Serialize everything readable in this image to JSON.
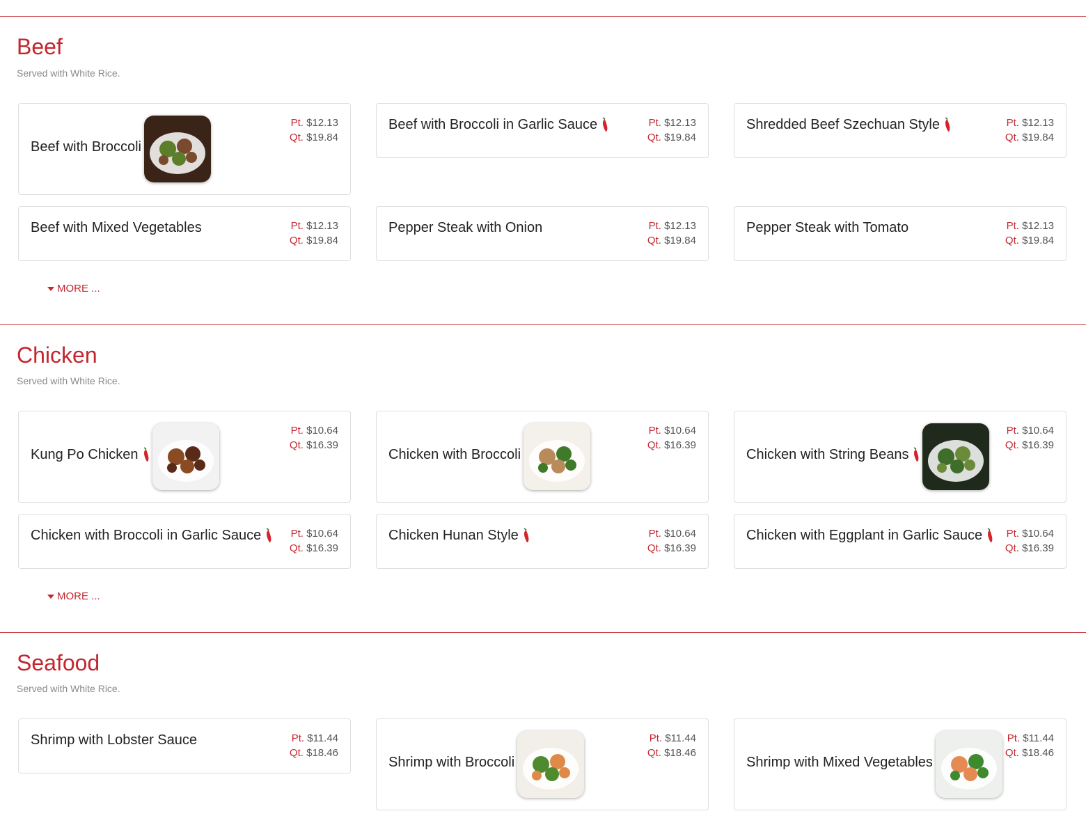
{
  "colors": {
    "accent": "#c4262e",
    "divider": "#c9454b",
    "border": "#dedede"
  },
  "price_labels": {
    "pint": "Pt.",
    "quart": "Qt."
  },
  "more_label": "MORE ...",
  "sections": [
    {
      "title": "Beef",
      "subtitle": "Served with White Rice.",
      "items": [
        {
          "name": "Beef with Broccoli",
          "spicy": false,
          "image": "beef-broccoli",
          "pt": "$12.13",
          "qt": "$19.84"
        },
        {
          "name": "Beef with Broccoli in Garlic Sauce",
          "spicy": true,
          "pt": "$12.13",
          "qt": "$19.84"
        },
        {
          "name": "Shredded Beef Szechuan Style",
          "spicy": true,
          "pt": "$12.13",
          "qt": "$19.84"
        },
        {
          "name": "Beef with Mixed Vegetables",
          "spicy": false,
          "pt": "$12.13",
          "qt": "$19.84"
        },
        {
          "name": "Pepper Steak with Onion",
          "spicy": false,
          "pt": "$12.13",
          "qt": "$19.84"
        },
        {
          "name": "Pepper Steak with Tomato",
          "spicy": false,
          "pt": "$12.13",
          "qt": "$19.84"
        }
      ]
    },
    {
      "title": "Chicken",
      "subtitle": "Served with White Rice.",
      "items": [
        {
          "name": "Kung Po Chicken",
          "spicy": true,
          "image": "kung-po-chicken",
          "pt": "$10.64",
          "qt": "$16.39"
        },
        {
          "name": "Chicken with Broccoli",
          "spicy": false,
          "image": "chicken-broccoli",
          "pt": "$10.64",
          "qt": "$16.39"
        },
        {
          "name": "Chicken with String Beans",
          "spicy": true,
          "image": "chicken-string-beans",
          "pt": "$10.64",
          "qt": "$16.39"
        },
        {
          "name": "Chicken with Broccoli in Garlic Sauce",
          "spicy": true,
          "pt": "$10.64",
          "qt": "$16.39"
        },
        {
          "name": "Chicken Hunan Style",
          "spicy": true,
          "pt": "$10.64",
          "qt": "$16.39"
        },
        {
          "name": "Chicken with Eggplant in Garlic Sauce",
          "spicy": true,
          "pt": "$10.64",
          "qt": "$16.39"
        }
      ]
    },
    {
      "title": "Seafood",
      "subtitle": "Served with White Rice.",
      "items": [
        {
          "name": "Shrimp with Lobster Sauce",
          "spicy": false,
          "pt": "$11.44",
          "qt": "$18.46"
        },
        {
          "name": "Shrimp with Broccoli",
          "spicy": false,
          "image": "shrimp-broccoli",
          "pt": "$11.44",
          "qt": "$18.46"
        },
        {
          "name": "Shrimp with Mixed Vegetables",
          "spicy": false,
          "image": "shrimp-mixed-vegetables",
          "pt": "$11.44",
          "qt": "$18.46"
        }
      ]
    }
  ]
}
